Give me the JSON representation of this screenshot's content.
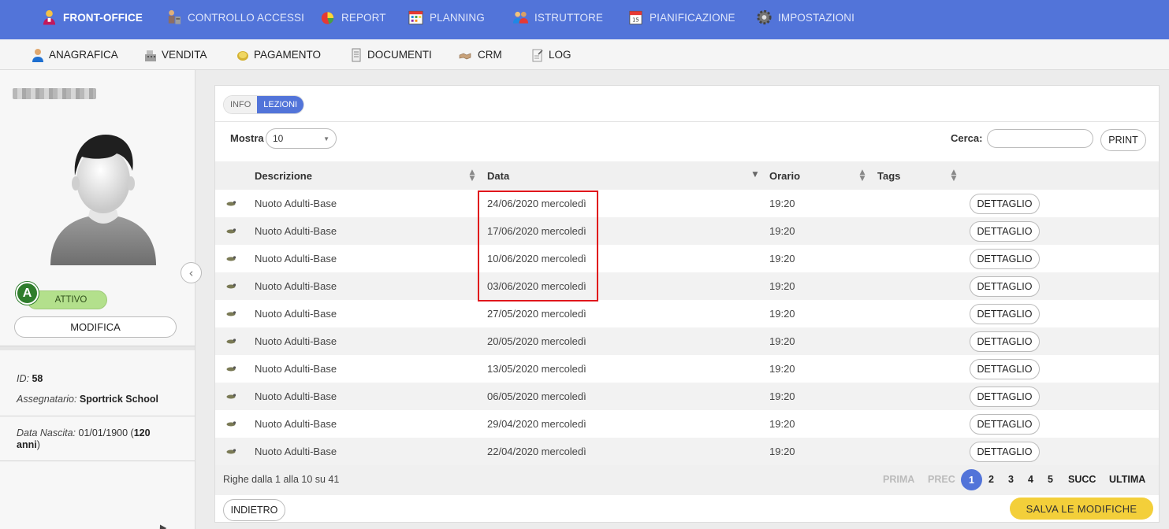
{
  "topnav": {
    "items": [
      {
        "label": "FRONT-OFFICE",
        "icon": "user-icon",
        "active": true
      },
      {
        "label": "CONTROLLO ACCESSI",
        "icon": "turnstile-icon"
      },
      {
        "label": "REPORT",
        "icon": "pie-chart-icon"
      },
      {
        "label": "PLANNING",
        "icon": "calendar-grid-icon"
      },
      {
        "label": "ISTRUTTORE",
        "icon": "people-icon"
      },
      {
        "label": "PIANIFICAZIONE",
        "icon": "calendar-icon"
      },
      {
        "label": "IMPOSTAZIONI",
        "icon": "gear-icon"
      }
    ]
  },
  "subnav": {
    "items": [
      {
        "label": "ANAGRAFICA",
        "icon": "person-icon"
      },
      {
        "label": "VENDITA",
        "icon": "cash-register-icon"
      },
      {
        "label": "PAGAMENTO",
        "icon": "coin-icon"
      },
      {
        "label": "DOCUMENTI",
        "icon": "document-icon"
      },
      {
        "label": "CRM",
        "icon": "handshake-icon"
      },
      {
        "label": "LOG",
        "icon": "log-icon"
      }
    ]
  },
  "sidebar": {
    "status_letter": "A",
    "status_label": "ATTIVO",
    "modifica_label": "MODIFICA",
    "id_label": "ID:",
    "id_value": "58",
    "assegnatario_label": "Assegnatario:",
    "assegnatario_value": "Sportrick School",
    "nascita_label": "Data Nascita:",
    "nascita_value": "01/01/1900 (",
    "eta_value": "120",
    "eta_unit": "anni",
    "nascita_close": ")"
  },
  "tabs": [
    {
      "label": "INFO",
      "active": false
    },
    {
      "label": "LEZIONI",
      "active": true
    }
  ],
  "controls": {
    "mostra_label": "Mostra",
    "mostra_value": "10",
    "cerca_label": "Cerca:",
    "cerca_value": "",
    "print_label": "PRINT"
  },
  "table": {
    "columns": [
      "Descrizione",
      "Data",
      "Orario",
      "Tags"
    ],
    "rows": [
      {
        "descrizione": "Nuoto Adulti-Base",
        "data": "24/06/2020 mercoledì",
        "orario": "19:20",
        "tags": "",
        "action": "DETTAGLIO"
      },
      {
        "descrizione": "Nuoto Adulti-Base",
        "data": "17/06/2020 mercoledì",
        "orario": "19:20",
        "tags": "",
        "action": "DETTAGLIO"
      },
      {
        "descrizione": "Nuoto Adulti-Base",
        "data": "10/06/2020 mercoledì",
        "orario": "19:20",
        "tags": "",
        "action": "DETTAGLIO"
      },
      {
        "descrizione": "Nuoto Adulti-Base",
        "data": "03/06/2020 mercoledì",
        "orario": "19:20",
        "tags": "",
        "action": "DETTAGLIO"
      },
      {
        "descrizione": "Nuoto Adulti-Base",
        "data": "27/05/2020 mercoledì",
        "orario": "19:20",
        "tags": "",
        "action": "DETTAGLIO"
      },
      {
        "descrizione": "Nuoto Adulti-Base",
        "data": "20/05/2020 mercoledì",
        "orario": "19:20",
        "tags": "",
        "action": "DETTAGLIO"
      },
      {
        "descrizione": "Nuoto Adulti-Base",
        "data": "13/05/2020 mercoledì",
        "orario": "19:20",
        "tags": "",
        "action": "DETTAGLIO"
      },
      {
        "descrizione": "Nuoto Adulti-Base",
        "data": "06/05/2020 mercoledì",
        "orario": "19:20",
        "tags": "",
        "action": "DETTAGLIO"
      },
      {
        "descrizione": "Nuoto Adulti-Base",
        "data": "29/04/2020 mercoledì",
        "orario": "19:20",
        "tags": "",
        "action": "DETTAGLIO"
      },
      {
        "descrizione": "Nuoto Adulti-Base",
        "data": "22/04/2020 mercoledì",
        "orario": "19:20",
        "tags": "",
        "action": "DETTAGLIO"
      }
    ]
  },
  "pagination": {
    "info": "Righe dalla 1 alla 10 su 41",
    "prima": "PRIMA",
    "prec": "PREC",
    "pages": [
      "1",
      "2",
      "3",
      "4",
      "5"
    ],
    "current_page": "1",
    "succ": "SUCC",
    "ultima": "ULTIMA"
  },
  "footer": {
    "indietro_label": "INDIETRO",
    "salva_label": "SALVA LE MODIFICHE"
  },
  "colors": {
    "primary": "#5274d9",
    "status_green": "#2f7d2c",
    "status_pill": "#b3e08c",
    "save_yellow": "#f3cf3a",
    "highlight_red": "#e0161b"
  }
}
